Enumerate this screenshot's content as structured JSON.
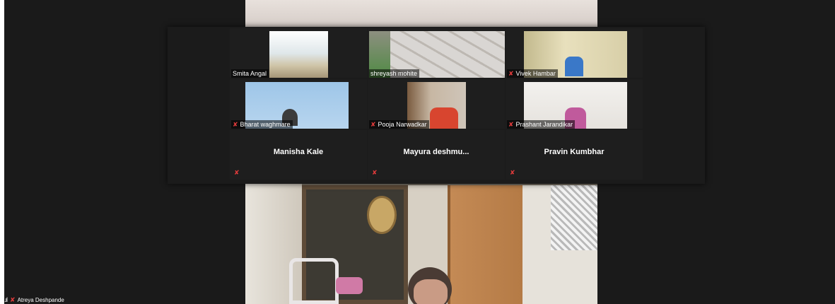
{
  "participants": [
    {
      "name": "Smita Angal",
      "muted": false
    },
    {
      "name": "shreyash mohite",
      "muted": false
    },
    {
      "name": "Vivek Hambar",
      "muted": true
    },
    {
      "name": "Bharat waghmare",
      "muted": true
    },
    {
      "name": "Pooja Narwadkar",
      "muted": true
    },
    {
      "name": "Prashant Jarandikar",
      "muted": true
    },
    {
      "name": "Manisha Kale",
      "muted": true
    },
    {
      "name": "Mayura  deshmu...",
      "muted": true
    },
    {
      "name": "Pravin Kumbhar",
      "muted": true
    }
  ],
  "self": {
    "name": "Atreya Deshpande",
    "signal_icon": ".ıl",
    "muted": true
  },
  "icons": {
    "mic_muted": "mic-muted-icon",
    "signal": "signal-icon"
  },
  "colors": {
    "background": "#1a1a1a",
    "muted_icon": "#e13b3b",
    "name_text": "#ffffff"
  }
}
